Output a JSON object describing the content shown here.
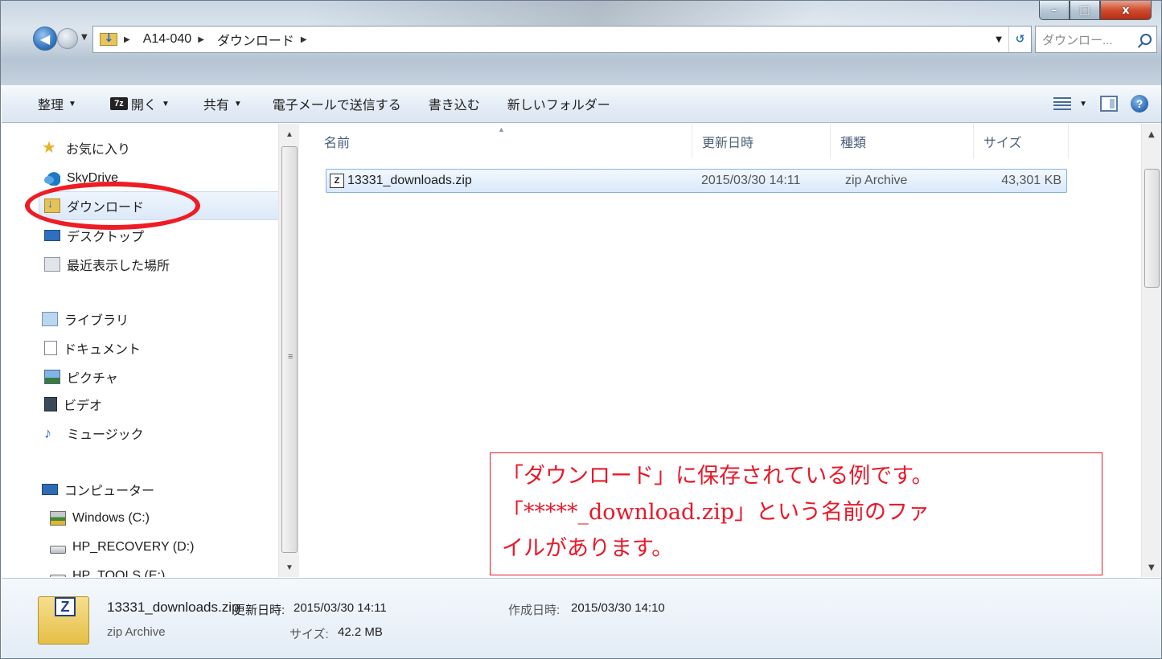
{
  "window": {
    "controls": {
      "minimize": "–",
      "maximize": "□",
      "close": "x"
    }
  },
  "address": {
    "crumbs": [
      "A14-040",
      "ダウンロード"
    ],
    "search_placeholder": "ダウンロー..."
  },
  "toolbar": {
    "organize": "整理",
    "open": "開く",
    "open_app_badge": "7z",
    "share": "共有",
    "email": "電子メールで送信する",
    "burn": "書き込む",
    "new_folder": "新しいフォルダー"
  },
  "nav": {
    "favorites": "お気に入り",
    "skydrive": "SkyDrive",
    "downloads": "ダウンロード",
    "desktop": "デスクトップ",
    "recent": "最近表示した場所",
    "libraries": "ライブラリ",
    "documents": "ドキュメント",
    "pictures": "ピクチャ",
    "videos": "ビデオ",
    "music": "ミュージック",
    "computer": "コンピューター",
    "drive_c": "Windows (C:)",
    "drive_d": "HP_RECOVERY (D:)",
    "drive_e": "HP_TOOLS (E:)"
  },
  "columns": {
    "name": "名前",
    "modified": "更新日時",
    "type": "種類",
    "size": "サイズ"
  },
  "files": [
    {
      "name": "13331_downloads.zip",
      "modified": "2015/03/30 14:11",
      "type": "zip Archive",
      "size": "43,301 KB"
    }
  ],
  "details": {
    "name": "13331_downloads.zip",
    "type": "zip Archive",
    "modified_label": "更新日時:",
    "modified": "2015/03/30 14:11",
    "size_label": "サイズ:",
    "size": "42.2 MB",
    "created_label": "作成日時:",
    "created": "2015/03/30 14:10"
  },
  "annotation": {
    "line1": "「ダウンロード」に保存されている例です。",
    "line2": "「*****_download.zip」という名前のファ",
    "line3": "イルがあります。"
  }
}
